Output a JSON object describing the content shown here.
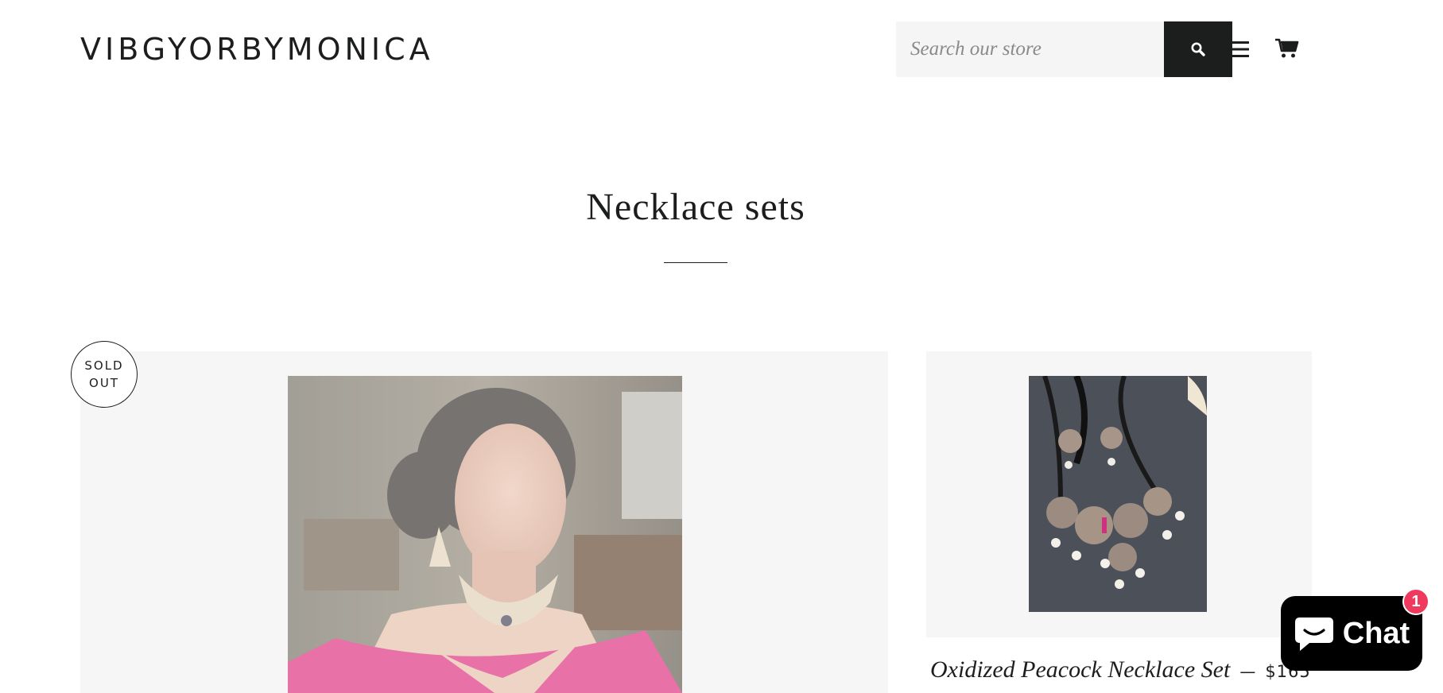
{
  "store": {
    "logo": "VIBGYORBYMONICA"
  },
  "search": {
    "placeholder": "Search our store",
    "value": ""
  },
  "icons": {
    "search": "search-icon",
    "menu": "hamburger-menu-icon",
    "cart": "cart-icon",
    "chat": "chat-bubble-icon"
  },
  "collection": {
    "title": "Necklace sets"
  },
  "products": [
    {
      "badge_line1": "SOLD",
      "badge_line2": "OUT"
    },
    {
      "name": "Oxidized Peacock Necklace Set",
      "separator": "—",
      "price": "$165"
    }
  ],
  "chat": {
    "label": "Chat",
    "badge_count": "1"
  },
  "colors": {
    "text": "#1c1d1d",
    "search_button": "#1c1d1d",
    "card_background": "#f6f6f6",
    "chat_background": "#000000",
    "chat_badge": "#ef3a5d",
    "saree_pink": "#e0207a"
  }
}
